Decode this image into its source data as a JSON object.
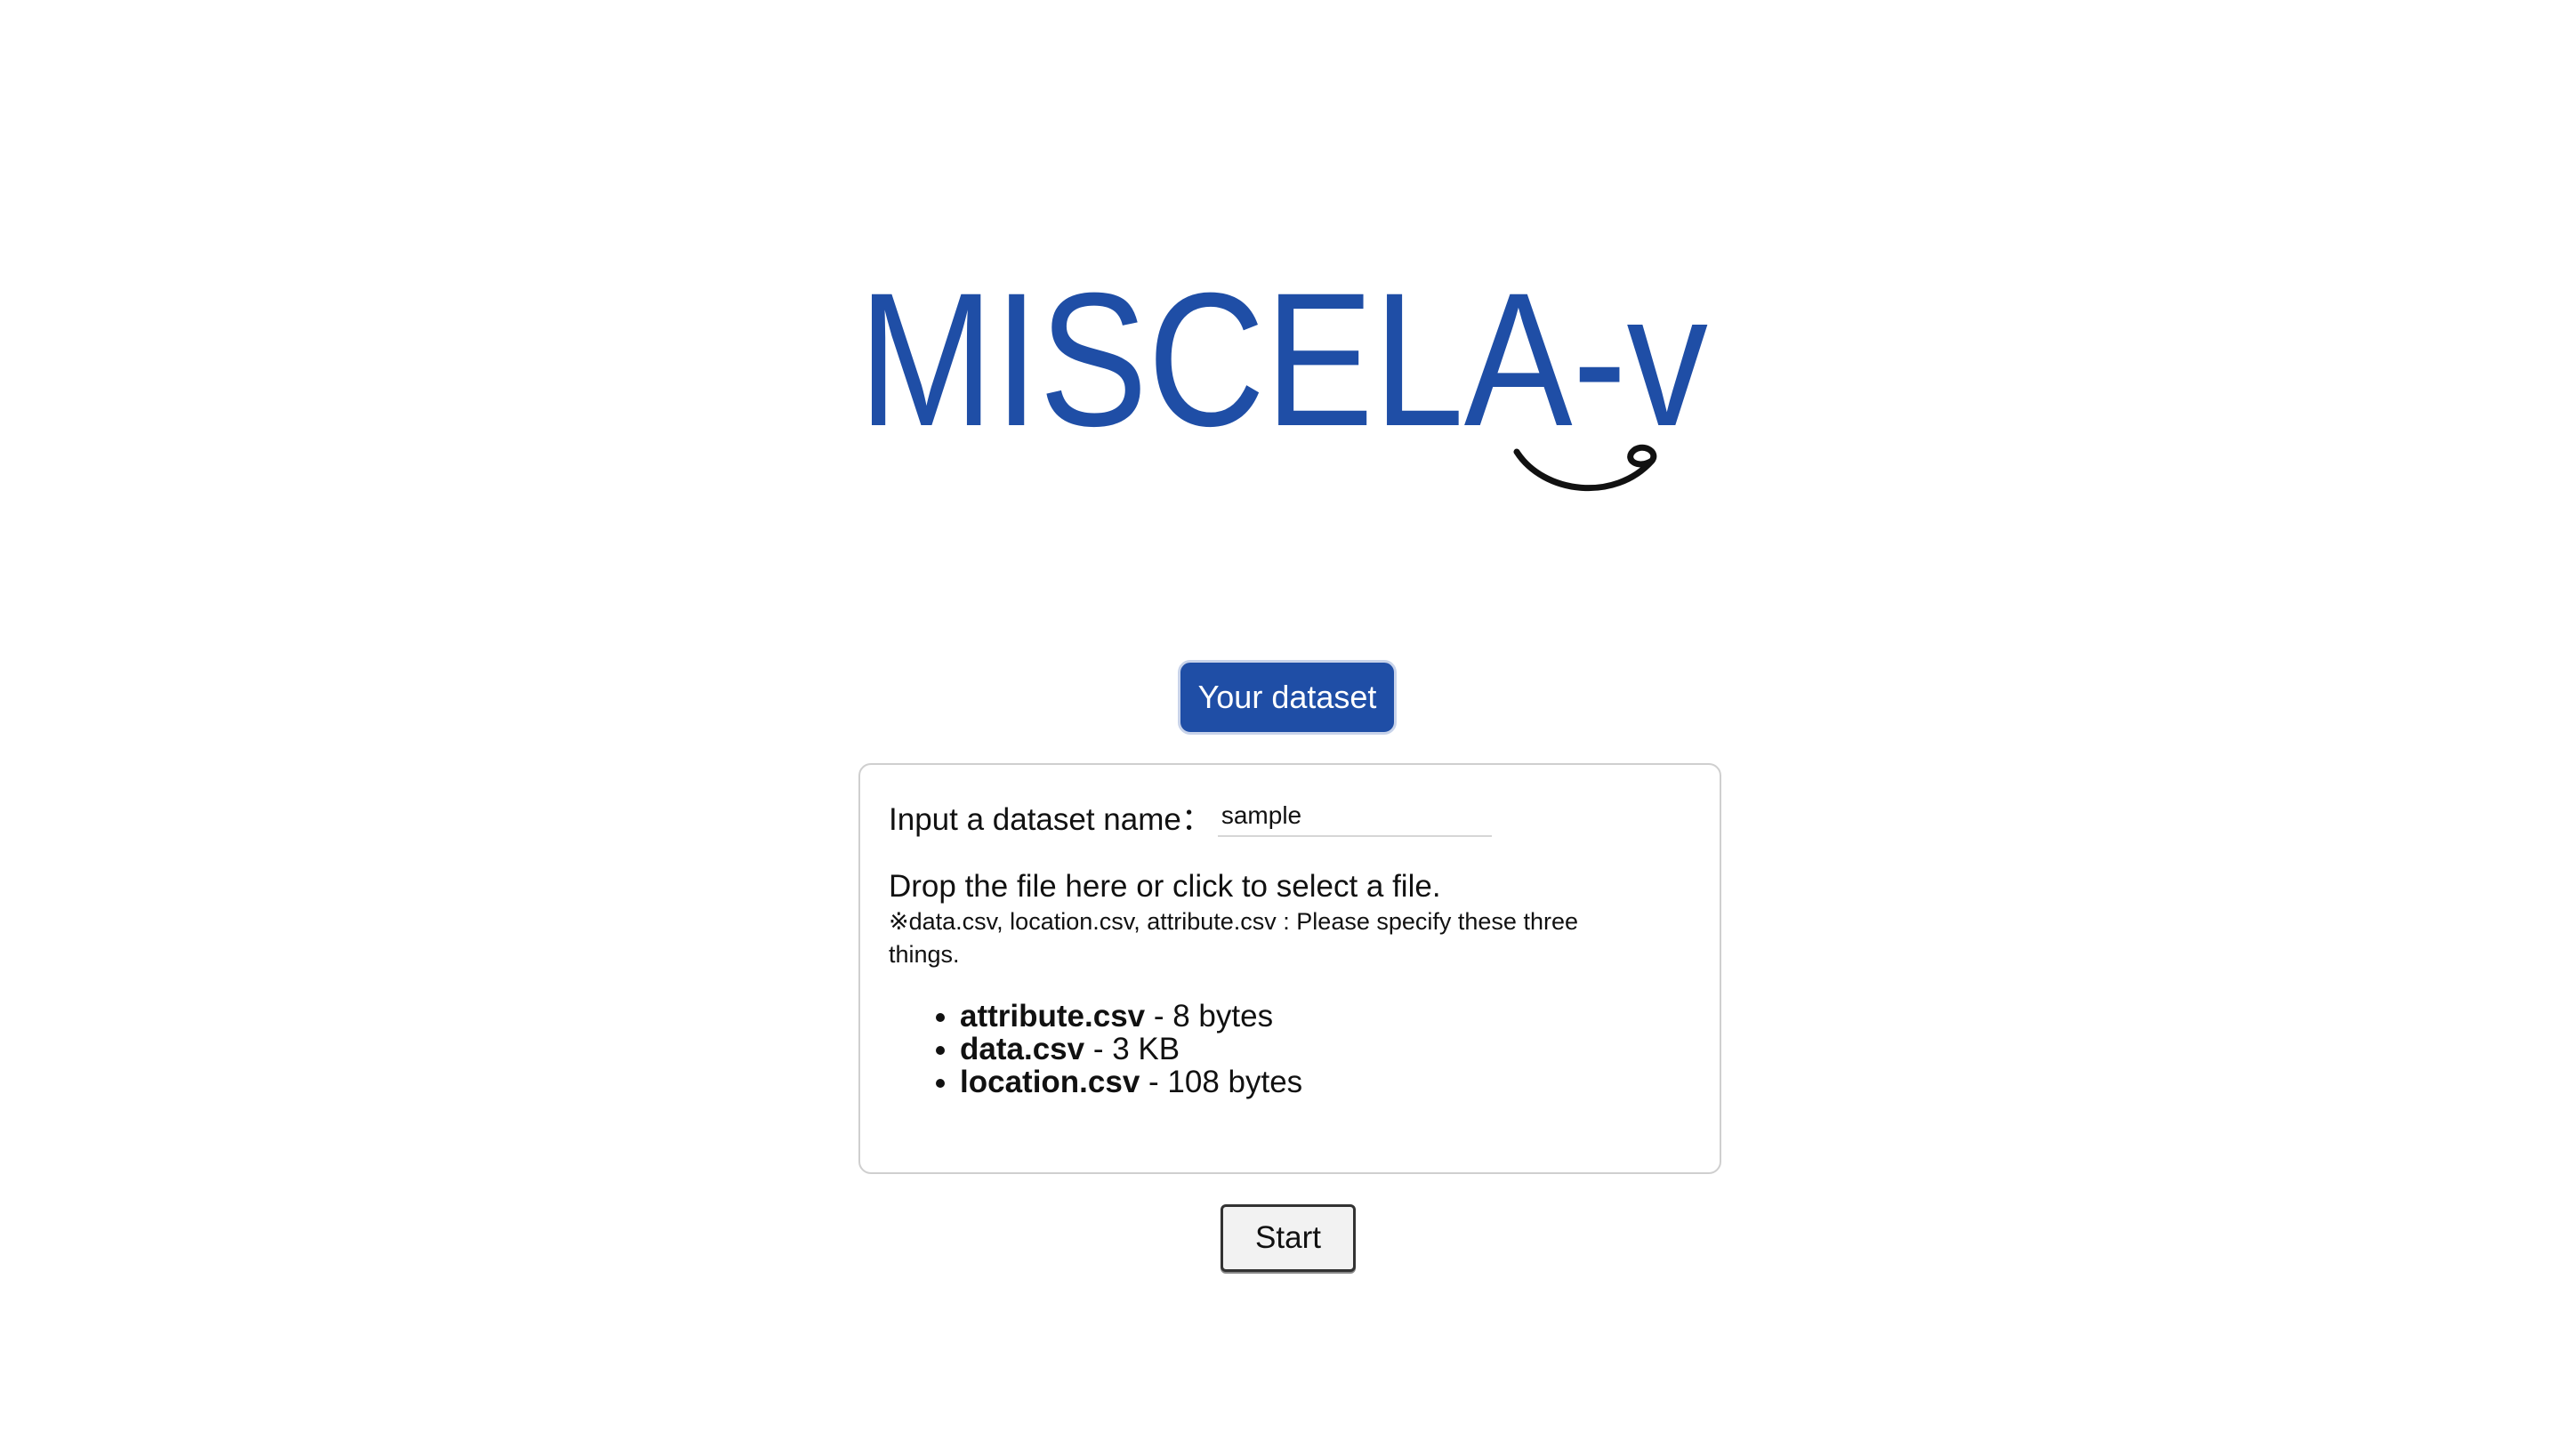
{
  "app": {
    "logo_text": "MISCELA-v"
  },
  "tabs": {
    "your_dataset_label": "Your dataset"
  },
  "form": {
    "name_label": "Input a dataset name：",
    "name_value": "sample",
    "drop_text": "Drop the file here or click to select a file.",
    "drop_note": "※data.csv, location.csv, attribute.csv : Please specify these three things."
  },
  "files": [
    {
      "name": "attribute.csv",
      "size": " - 8 bytes"
    },
    {
      "name": "data.csv",
      "size": " - 3 KB"
    },
    {
      "name": "location.csv",
      "size": " - 108 bytes"
    }
  ],
  "actions": {
    "start_label": "Start"
  },
  "colors": {
    "brand": "#1f4ea6"
  },
  "icons": {
    "logo_mark": "smile-swoosh-icon"
  }
}
